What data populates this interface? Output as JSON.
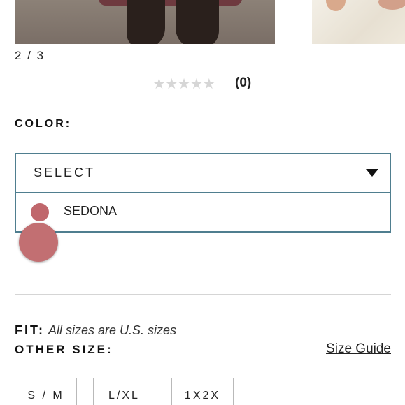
{
  "gallery": {
    "counter": "2 / 3"
  },
  "rating": {
    "stars_filled": 0,
    "stars_total": 5,
    "review_count": "(0)"
  },
  "color": {
    "label": "COLOR:",
    "select_value": "SELECT",
    "options": [
      {
        "name": "SEDONA",
        "swatch_color": "#c0676c"
      }
    ]
  },
  "fit": {
    "label": "FIT:",
    "value": "All sizes are U.S. sizes"
  },
  "size": {
    "label": "OTHER SIZE:",
    "guide_link": "Size Guide",
    "options": [
      "S / M",
      "L/XL",
      "1X2X"
    ]
  },
  "colors": {
    "select_border": "#4f7e8f",
    "swatch_sedona": "#c0676c"
  }
}
